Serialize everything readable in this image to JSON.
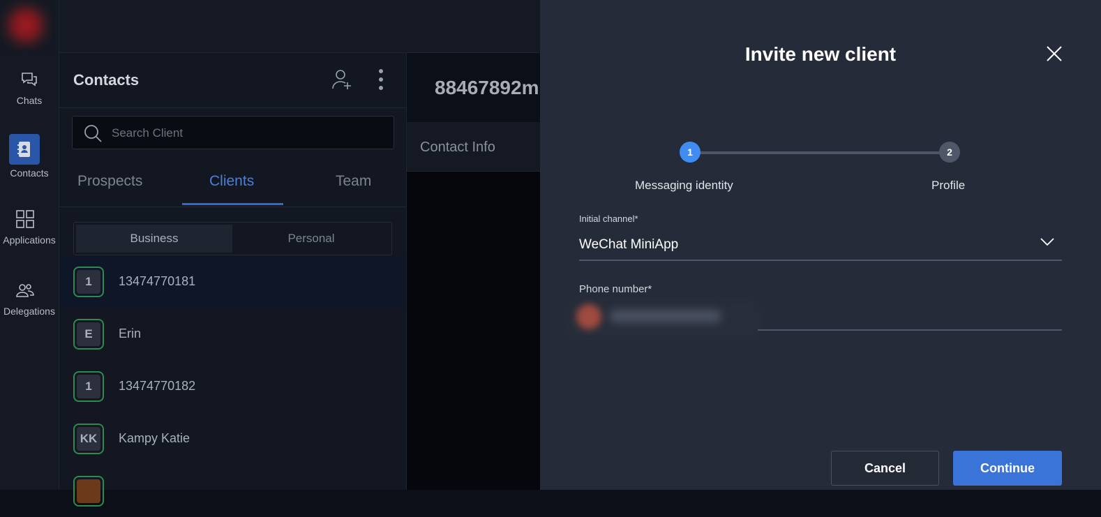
{
  "rail": {
    "items": [
      {
        "label": "Chats",
        "icon": "chat-bubbles-icon"
      },
      {
        "label": "Contacts",
        "icon": "address-book-icon",
        "active": true
      },
      {
        "label": "Applications",
        "icon": "grid-icon"
      },
      {
        "label": "Delegations",
        "icon": "people-icon"
      }
    ]
  },
  "contacts": {
    "title": "Contacts",
    "search_placeholder": "Search Client",
    "tabs": [
      "Prospects",
      "Clients",
      "Team"
    ],
    "active_tab": "Clients",
    "segments": [
      "Business",
      "Personal"
    ],
    "active_segment": "Business",
    "rows": [
      {
        "initials": "1",
        "name": "13474770181",
        "selected": true
      },
      {
        "initials": "E",
        "name": "Erin"
      },
      {
        "initials": "1",
        "name": "13474770182"
      },
      {
        "initials": "KK",
        "name": "Kampy Katie"
      }
    ]
  },
  "middle": {
    "header_number": "88467892m",
    "section_label": "Contact Info"
  },
  "modal": {
    "title": "Invite new client",
    "steps": [
      {
        "number": "1",
        "label": "Messaging identity",
        "active": true
      },
      {
        "number": "2",
        "label": "Profile"
      }
    ],
    "channel_label": "Initial channel*",
    "channel_value": "WeChat MiniApp",
    "phone_label": "Phone number*",
    "cancel_label": "Cancel",
    "continue_label": "Continue"
  },
  "colors": {
    "accent": "#3a74d9",
    "step_active": "#3f8df2",
    "avatar_border": "#2f8a52"
  }
}
